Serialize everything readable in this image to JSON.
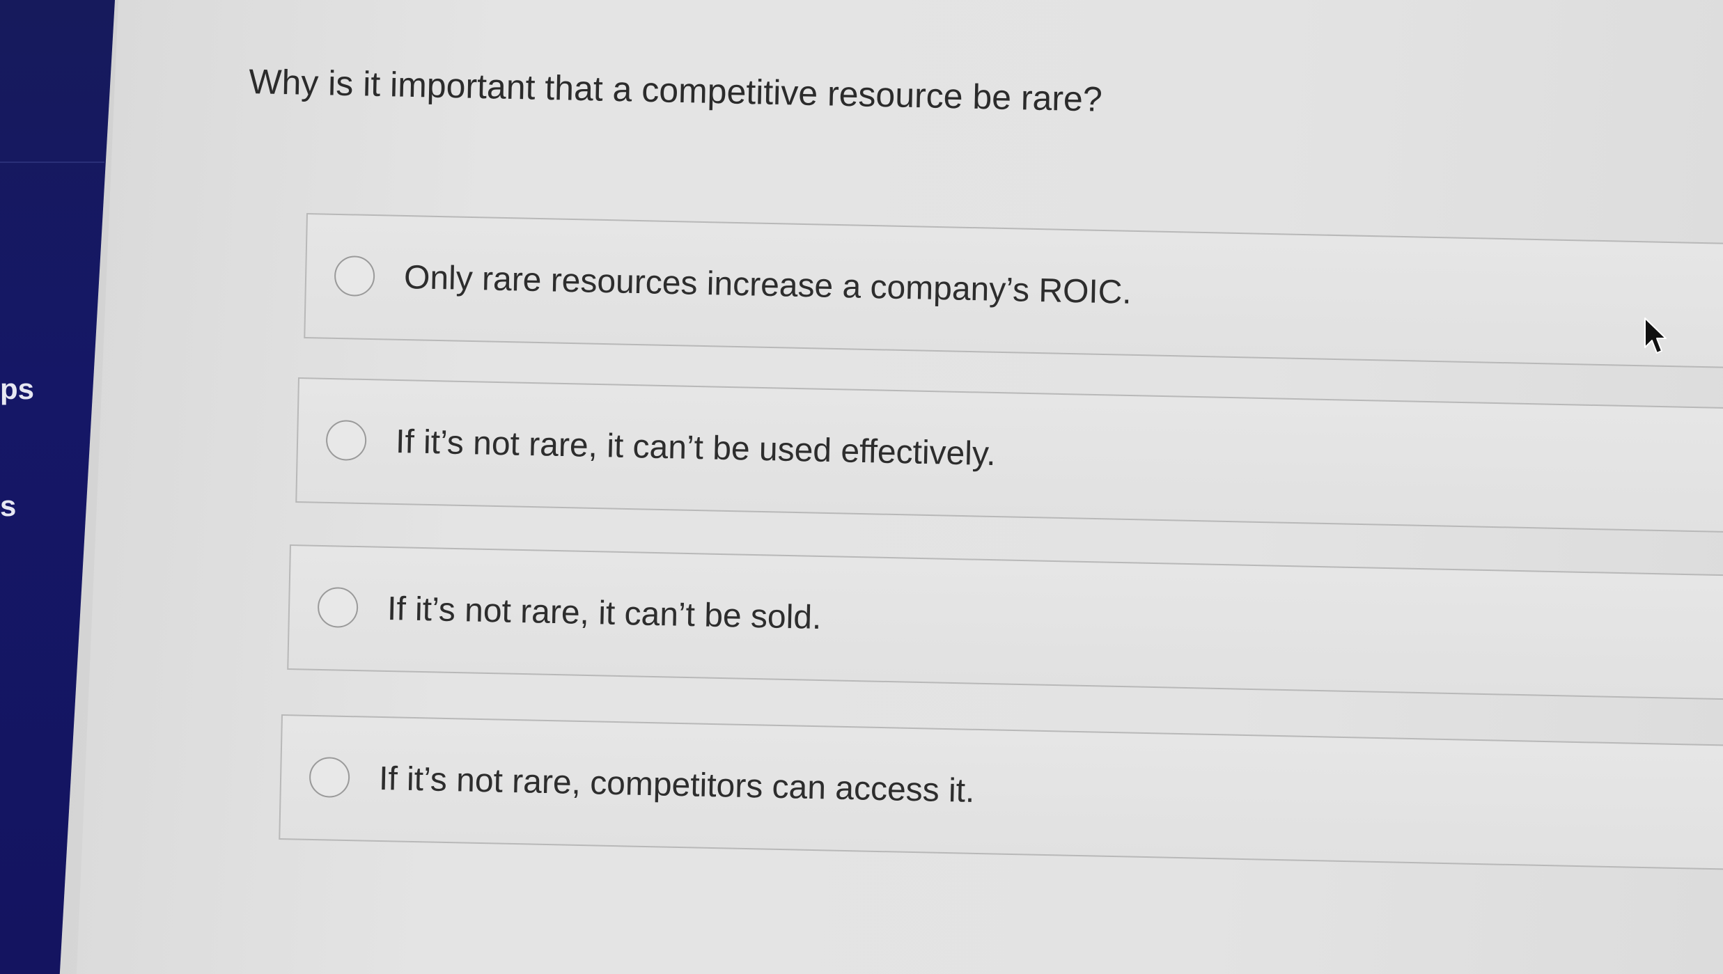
{
  "sidebar": {
    "labels": [
      "ps",
      "s"
    ]
  },
  "question": {
    "text": "Why is it important that a competitive resource be rare?"
  },
  "choices": [
    {
      "label": "Only rare resources increase a company’s ROIC."
    },
    {
      "label": "If it’s not rare, it can’t be used effectively."
    },
    {
      "label": "If it’s not rare, it can’t be sold."
    },
    {
      "label": "If it’s not rare, competitors can access it."
    }
  ],
  "colors": {
    "sidebar": "#151766",
    "background": "#e2e2e2",
    "text": "#2d2d2d"
  },
  "icons": {
    "radio": "radio-button-icon",
    "cursor": "mouse-pointer-icon"
  }
}
